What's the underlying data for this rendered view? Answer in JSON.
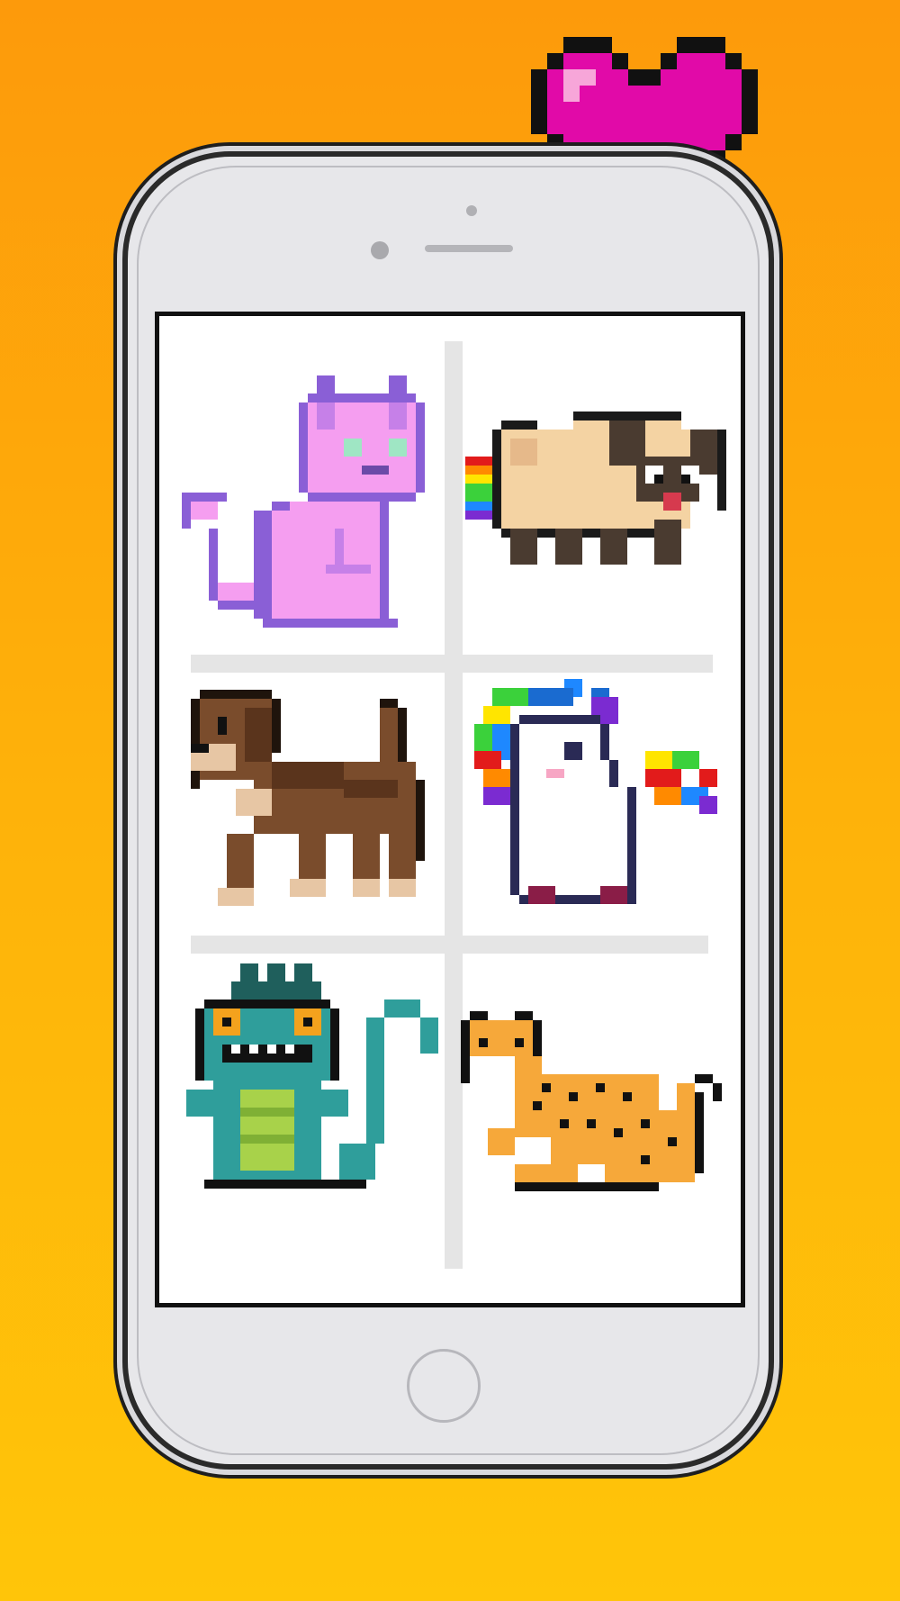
{
  "background": {
    "gradient_top": "#fd9a0b",
    "gradient_bottom": "#ffc509"
  },
  "decoration": {
    "icon": "pixel-heart-icon",
    "color": "#e10aa8"
  },
  "gallery": {
    "items": [
      {
        "name": "cat",
        "icon": "pixel-cat-icon",
        "main_color": "#f59ef0"
      },
      {
        "name": "pug",
        "icon": "pixel-pug-icon",
        "main_color": "#f4d3a3"
      },
      {
        "name": "dachshund",
        "icon": "pixel-dachshund-icon",
        "main_color": "#7a4c2c"
      },
      {
        "name": "unicorn",
        "icon": "pixel-unicorn-icon",
        "main_color": "#ffffff"
      },
      {
        "name": "lizard-monster",
        "icon": "pixel-lizard-monster-icon",
        "main_color": "#2f9e9b"
      },
      {
        "name": "leopard",
        "icon": "pixel-leopard-icon",
        "main_color": "#f6a83a"
      }
    ]
  }
}
